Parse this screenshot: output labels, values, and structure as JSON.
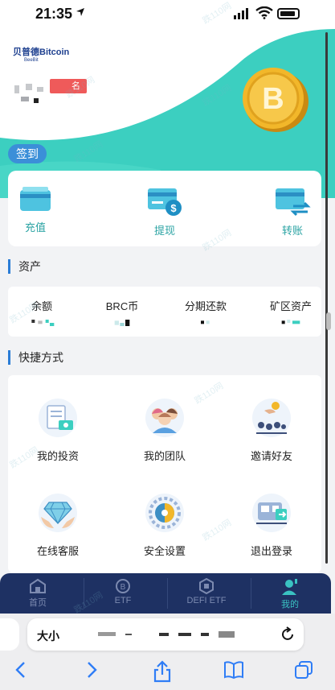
{
  "status_bar": {
    "time": "21:35"
  },
  "header": {
    "logo_text": "贝普德Bitcoin",
    "logo_sub": "BeeBit",
    "rank_suffix": "名",
    "checkin_label": "签到"
  },
  "wallet": {
    "items": [
      {
        "label": "充值",
        "icon": "deposit-card-icon"
      },
      {
        "label": "提现",
        "icon": "withdraw-card-icon"
      },
      {
        "label": "转账",
        "icon": "transfer-card-icon"
      }
    ]
  },
  "assets": {
    "title": "资产",
    "items": [
      {
        "name": "余额"
      },
      {
        "name": "BRC币"
      },
      {
        "name": "分期还款"
      },
      {
        "name": "矿区资产"
      }
    ]
  },
  "shortcuts": {
    "title": "快捷方式",
    "items": [
      {
        "label": "我的投资",
        "icon": "investment-icon"
      },
      {
        "label": "我的团队",
        "icon": "team-icon"
      },
      {
        "label": "邀请好友",
        "icon": "invite-icon"
      },
      {
        "label": "在线客服",
        "icon": "support-icon"
      },
      {
        "label": "安全设置",
        "icon": "security-icon"
      },
      {
        "label": "退出登录",
        "icon": "logout-icon"
      }
    ]
  },
  "tabbar": {
    "tabs": [
      {
        "label": "首页",
        "icon": "home-icon"
      },
      {
        "label": "ETF",
        "icon": "etf-icon"
      },
      {
        "label": "DEFI ETF",
        "icon": "defi-icon"
      },
      {
        "label": "我的",
        "icon": "profile-icon",
        "active": true
      }
    ]
  },
  "browser": {
    "aa_label": "大小"
  },
  "watermark": "跌110网",
  "colors": {
    "teal": "#3ccfc0",
    "navy": "#1e3163",
    "accent": "#2aa3a3",
    "blue": "#3b8fd8"
  }
}
